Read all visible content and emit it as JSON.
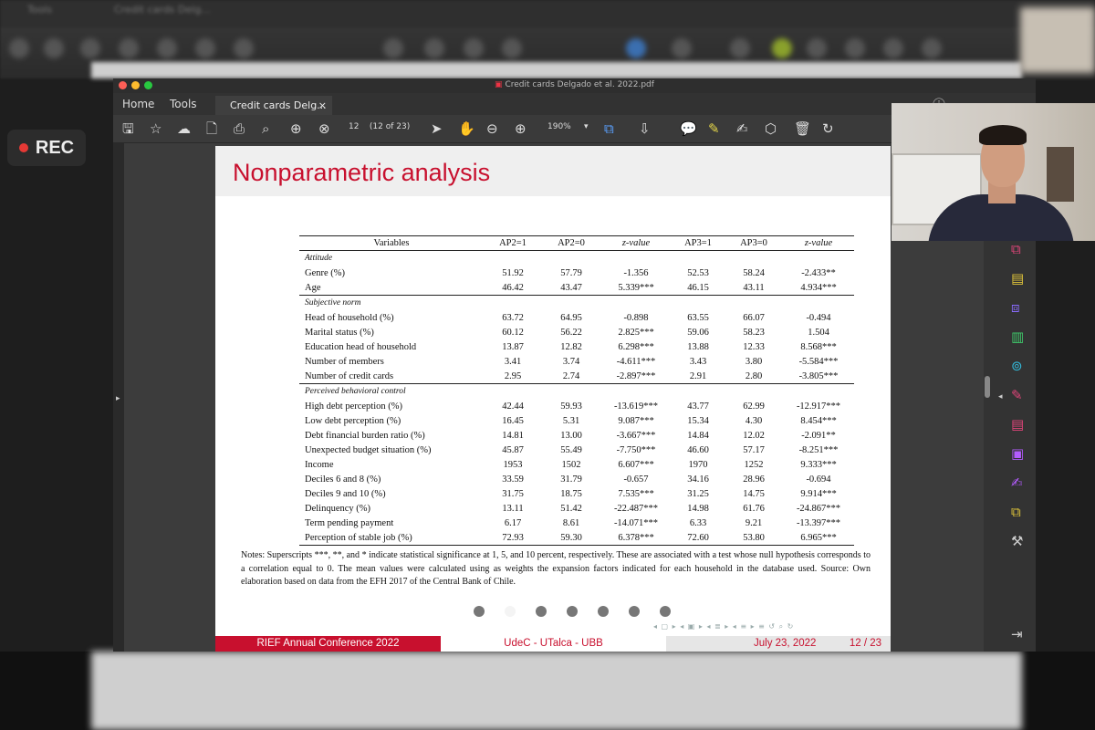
{
  "background_top": {
    "tab_labels": [
      "Tools",
      "Credit cards Delg..."
    ]
  },
  "recording": {
    "label": "REC",
    "dot_color": "#e53935"
  },
  "window": {
    "title": "Credit cards Delgado et al. 2022.pdf",
    "menu": [
      "Home",
      "Tools"
    ],
    "tab": {
      "label": "Credit cards Delg...",
      "close": "×"
    },
    "toolbar": {
      "page_number": "12",
      "page_count": "(12 of 23)",
      "zoom": "190%",
      "icons": [
        "save-icon",
        "star-icon",
        "cloud-upload-icon",
        "file-icon",
        "print-icon",
        "zoom-search-icon",
        "page-up-icon",
        "page-down-icon",
        "cursor-icon",
        "hand-icon",
        "zoom-out-icon",
        "zoom-in-icon",
        "fit-icon",
        "scroll-icon",
        "comment-icon",
        "highlight-icon",
        "sign-icon",
        "stamp-icon",
        "trash-icon",
        "rotate-icon"
      ]
    },
    "right_panel_icons": [
      "pdf-export-icon",
      "comment-icon",
      "organize-icon",
      "edit-icon",
      "compress-icon",
      "fill-sign-icon",
      "create-pdf-icon",
      "form-icon",
      "sign-icon",
      "protect-icon",
      "tools-icon"
    ],
    "accent": "#c8102e"
  },
  "slide": {
    "title": "Nonparametric analysis",
    "table": {
      "headers": [
        "Variables",
        "AP2=1",
        "AP2=0",
        "z-value",
        "AP3=1",
        "AP3=0",
        "z-value"
      ],
      "sections": [
        {
          "name": "Attitude",
          "rows": [
            [
              "Genre (%)",
              "51.92",
              "57.79",
              "-1.356",
              "52.53",
              "58.24",
              "-2.433**"
            ],
            [
              "Age",
              "46.42",
              "43.47",
              "5.339***",
              "46.15",
              "43.11",
              "4.934***"
            ]
          ]
        },
        {
          "name": "Subjective norm",
          "rows": [
            [
              "Head of household (%)",
              "63.72",
              "64.95",
              "-0.898",
              "63.55",
              "66.07",
              "-0.494"
            ],
            [
              "Marital status (%)",
              "60.12",
              "56.22",
              "2.825***",
              "59.06",
              "58.23",
              "1.504"
            ],
            [
              "Education head of household",
              "13.87",
              "12.82",
              "6.298***",
              "13.88",
              "12.33",
              "8.568***"
            ],
            [
              "Number of members",
              "3.41",
              "3.74",
              "-4.611***",
              "3.43",
              "3.80",
              "-5.584***"
            ],
            [
              "Number of credit cards",
              "2.95",
              "2.74",
              "-2.897***",
              "2.91",
              "2.80",
              "-3.805***"
            ]
          ]
        },
        {
          "name": "Perceived behavioral control",
          "rows": [
            [
              "High debt perception (%)",
              "42.44",
              "59.93",
              "-13.619***",
              "43.77",
              "62.99",
              "-12.917***"
            ],
            [
              "Low debt perception (%)",
              "16.45",
              "5.31",
              "9.087***",
              "15.34",
              "4.30",
              "8.454***"
            ],
            [
              "Debt financial burden ratio (%)",
              "14.81",
              "13.00",
              "-3.667***",
              "14.84",
              "12.02",
              "-2.091**"
            ],
            [
              "Unexpected budget situation (%)",
              "45.87",
              "55.49",
              "-7.750***",
              "46.60",
              "57.17",
              "-8.251***"
            ],
            [
              "Income",
              "1953",
              "1502",
              "6.607***",
              "1970",
              "1252",
              "9.333***"
            ],
            [
              "Deciles 6 and 8 (%)",
              "33.59",
              "31.79",
              "-0.657",
              "34.16",
              "28.96",
              "-0.694"
            ],
            [
              "Deciles 9 and 10 (%)",
              "31.75",
              "18.75",
              "7.535***",
              "31.25",
              "14.75",
              "9.914***"
            ],
            [
              "Delinquency (%)",
              "13.11",
              "51.42",
              "-22.487***",
              "14.98",
              "61.76",
              "-24.867***"
            ],
            [
              "Term pending payment",
              "6.17",
              "8.61",
              "-14.071***",
              "6.33",
              "9.21",
              "-13.397***"
            ],
            [
              "Perception of stable job (%)",
              "72.93",
              "59.30",
              "6.378***",
              "72.60",
              "53.80",
              "6.965***"
            ]
          ]
        }
      ]
    },
    "notes": "Notes: Superscripts ***, **, and * indicate statistical significance at 1, 5, and 10 percent, respectively. These are associated with a test whose null hypothesis corresponds to a correlation equal to 0. The mean values were calculated using as weights the expansion factors indicated for each household in the database used. Source: Own elaboration based on data from the EFH 2017 of the Central Bank of Chile.",
    "footer": {
      "left": "RIEF Annual Conference 2022",
      "center": "UdeC - UTalca - UBB",
      "date": "July 23, 2022",
      "page": "12 / 23"
    }
  }
}
